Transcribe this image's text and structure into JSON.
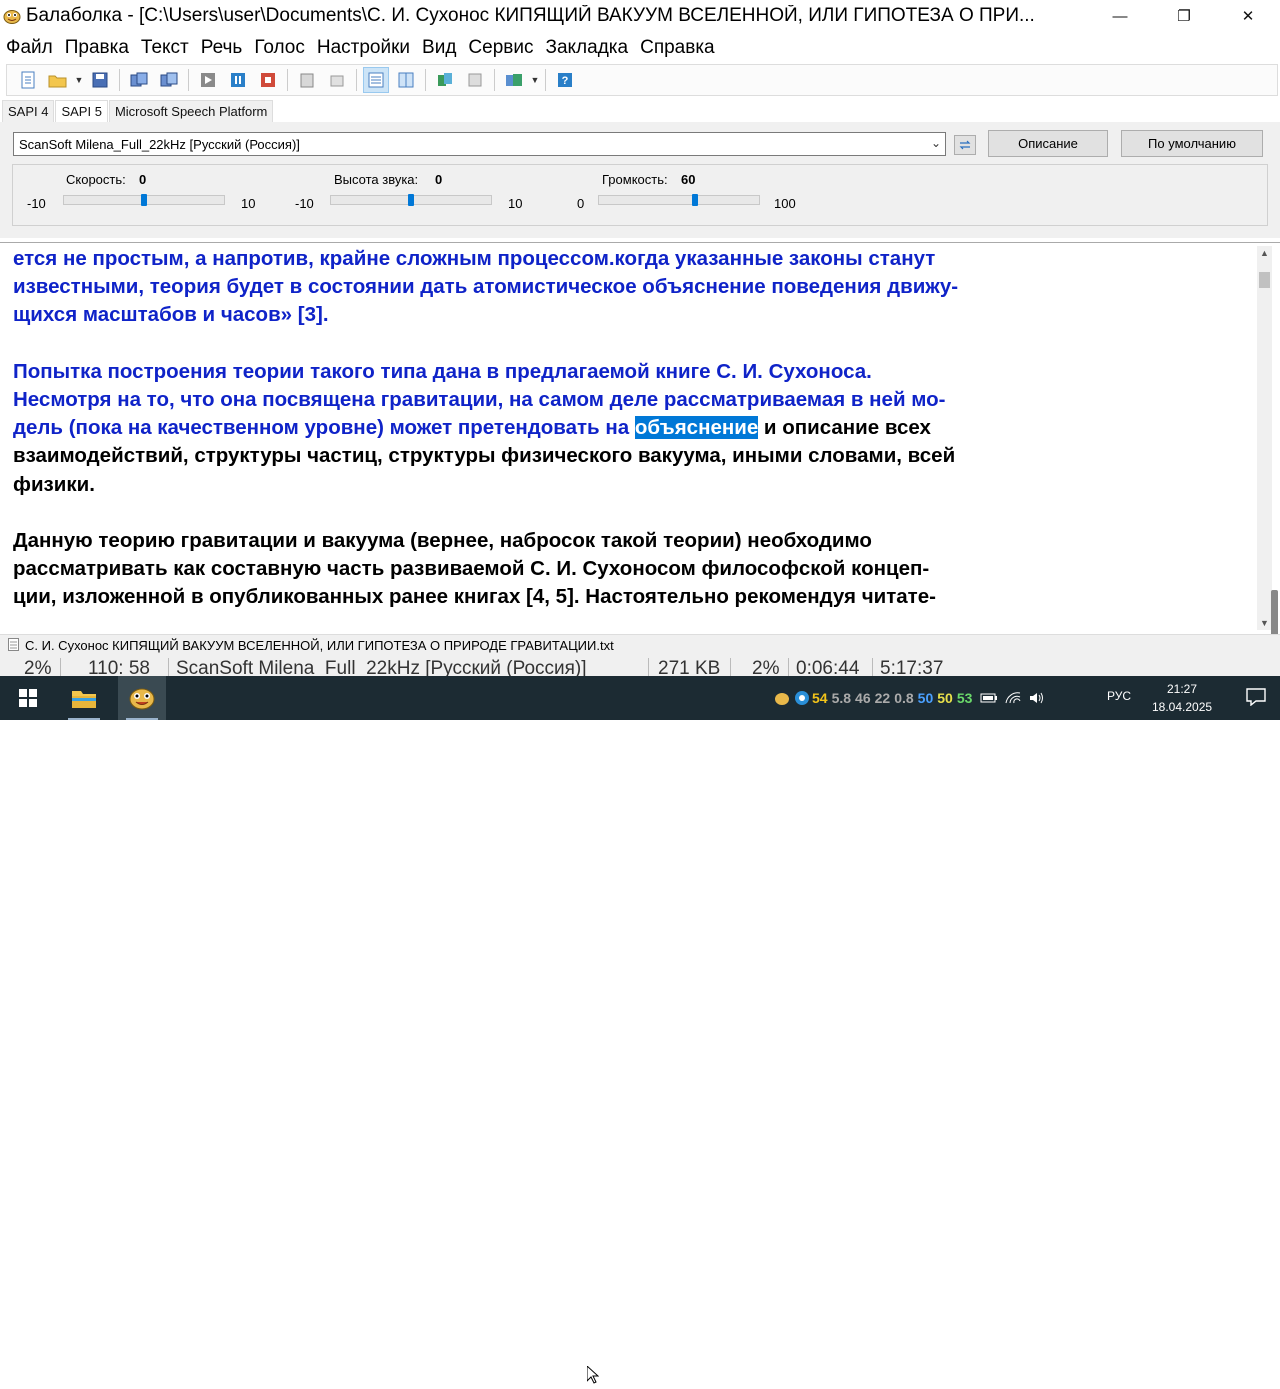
{
  "window": {
    "title": "Балаболка - [C:\\Users\\user\\Documents\\С. И. Сухонос КИПЯЩИЙ ВАКУУМ ВСЕЛЕННОЙ, ИЛИ ГИПОТЕЗА О ПРИ...",
    "minimize": "—",
    "maximize": "❐",
    "close": "✕"
  },
  "menu": [
    "Файл",
    "Правка",
    "Текст",
    "Речь",
    "Голос",
    "Настройки",
    "Вид",
    "Сервис",
    "Закладка",
    "Справка"
  ],
  "tabs": [
    "SAPI 4",
    "SAPI 5",
    "Microsoft Speech Platform"
  ],
  "selected_tab": "SAPI 5",
  "voice": {
    "selected": "ScanSoft Milena_Full_22kHz [Русский (Россия)]",
    "description_button": "Описание",
    "default_button": "По умолчанию"
  },
  "sliders": {
    "speed": {
      "label": "Скорость:",
      "value": "0",
      "min": "-10",
      "max": "10",
      "fraction": 0.5
    },
    "pitch": {
      "label": "Высота звука:",
      "value": "0",
      "min": "-10",
      "max": "10",
      "fraction": 0.5
    },
    "volume": {
      "label": "Громкость:",
      "value": "60",
      "min": "0",
      "max": "100",
      "fraction": 0.6
    }
  },
  "document": {
    "p1": [
      "ется не простым, а напротив, крайне сложным процессом.когда указанные законы станут",
      "известными, теория будет в состоянии дать атомистическое объяснение поведения движу-",
      "щихся масштабов и часов» [3]."
    ],
    "p2_blue": [
      "Попытка построения теории такого типа дана в предлагаемой книге С. И. Сухоноса.",
      "Несмотря на то, что она посвящена гравитации, на самом деле рассматриваемая в ней мо-"
    ],
    "p2_line3_blue": "дель (пока на качественном уровне) может претендовать на ",
    "p2_highlight": "объяснение",
    "p2_line3_black": " и описание всех",
    "p2_black": [
      "взаимодействий, структуры частиц, структуры физического вакуума, иными словами, всей",
      "физики."
    ],
    "p3": [
      "Данную теорию гравитации и вакуума (вернее, набросок такой теории) необходимо",
      "рассматривать как составную часть развиваемой С. И. Сухоносом философской концеп-",
      "ции, изложенной в опубликованных ранее книгах [4, 5]. Настоятельно рекомендуя читате-"
    ]
  },
  "file_tab": "С. И. Сухонос КИПЯЩИЙ ВАКУУМ ВСЕЛЕННОЙ, ИЛИ ГИПОТЕЗА О ПРИРОДЕ ГРАВИТАЦИИ.txt",
  "status": {
    "percent": "2%",
    "position": "110:  58",
    "voice": "ScanSoft Milena_Full_22kHz [Русский (Россия)]",
    "size": "271 KB",
    "progress": "2%",
    "elapsed": "0:06:44",
    "total": "5:17:37"
  },
  "taskbar": {
    "tray_numbers": [
      "54",
      "5.8",
      "46",
      "22",
      "0.8",
      "50",
      "50",
      "53"
    ],
    "language": "РУС",
    "time": "21:27",
    "date": "18.04.2025"
  },
  "colors": {
    "text_blue": "#0f23c8",
    "highlight": "#0078d7",
    "taskbar": "#1c2b33"
  }
}
